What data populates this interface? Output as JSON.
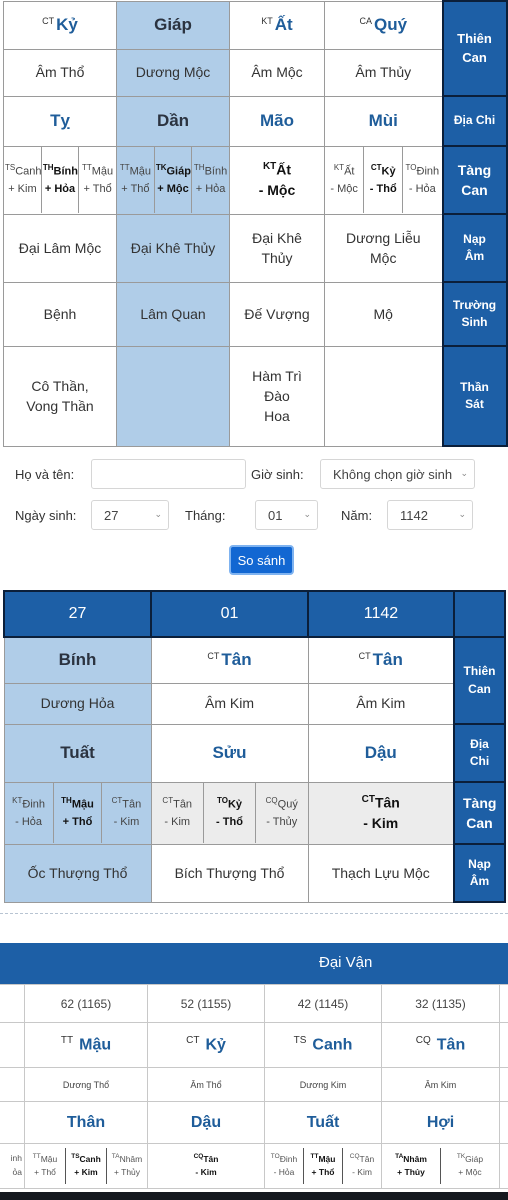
{
  "chart1": {
    "side_labels": {
      "thien_can": "Thiên Can",
      "dia_chi": "Địa Chi",
      "tang_can": "Tàng Can",
      "nap_am": "Nạp Âm",
      "truong_sinh": "Trường Sinh",
      "than_sat": "Thần Sát"
    },
    "columns": [
      {
        "can_sup": "CT",
        "can": "Kỷ",
        "can_hanh": "Âm Thổ",
        "chi": "Tỵ",
        "tang_can": [
          {
            "sup": "TS",
            "name": "Canh",
            "hanh": "+ Kim",
            "bold": false
          },
          {
            "sup": "TH",
            "name": "Bính",
            "hanh": "+ Hỏa",
            "bold": true
          },
          {
            "sup": "TT",
            "name": "Mậu",
            "hanh": "+ Thổ",
            "bold": false
          }
        ],
        "nap_am": "Đại Lâm Mộc",
        "truong_sinh": "Bệnh",
        "than_sat": "Cô Thần, Vong Thần"
      },
      {
        "can_sup": "",
        "can": "Giáp",
        "can_hanh": "Dương Mộc",
        "chi": "Dần",
        "tang_can": [
          {
            "sup": "TT",
            "name": "Mậu",
            "hanh": "+ Thổ",
            "bold": false
          },
          {
            "sup": "TK",
            "name": "Giáp",
            "hanh": "+ Mộc",
            "bold": true
          },
          {
            "sup": "TH",
            "name": "Bính",
            "hanh": "+ Hỏa",
            "bold": false
          }
        ],
        "nap_am": "Đại Khê Thủy",
        "truong_sinh": "Lâm Quan",
        "than_sat": ""
      },
      {
        "can_sup": "KT",
        "can": "Ất",
        "can_hanh": "Âm Mộc",
        "chi": "Mão",
        "tang_can": [
          {
            "sup": "KT",
            "name": "Ất",
            "hanh": "- Mộc",
            "bold": true
          }
        ],
        "nap_am": "Đại Khê Thủy",
        "truong_sinh": "Đế Vượng",
        "than_sat": "Hàm Trì Đào Hoa"
      },
      {
        "can_sup": "CA",
        "can": "Quý",
        "can_hanh": "Âm Thủy",
        "chi": "Mùi",
        "tang_can": [
          {
            "sup": "KT",
            "name": "Ất",
            "hanh": "- Mộc",
            "bold": false
          },
          {
            "sup": "CT",
            "name": "Kỷ",
            "hanh": "- Thổ",
            "bold": true
          },
          {
            "sup": "TO",
            "name": "Đinh",
            "hanh": "- Hỏa",
            "bold": false
          }
        ],
        "nap_am": "Dương Liễu Mộc",
        "truong_sinh": "Mộ",
        "than_sat": ""
      }
    ]
  },
  "form": {
    "name_label": "Họ và tên:",
    "name_value": "",
    "hour_label": "Giờ sinh:",
    "hour_value": "Không chọn giờ sinh",
    "day_label": "Ngày sinh:",
    "day_value": "27",
    "month_label": "Tháng:",
    "month_value": "01",
    "year_label": "Năm:",
    "year_value": "1142",
    "compare_button": "So sánh"
  },
  "chart2": {
    "headers": [
      "27",
      "01",
      "1142"
    ],
    "side_labels": {
      "thien_can": "Thiên Can",
      "dia_chi": "Địa Chi",
      "tang_can": "Tàng Can",
      "nap_am": "Nạp Âm"
    },
    "columns": [
      {
        "can_sup": "",
        "can": "Bính",
        "can_hanh": "Dương Hỏa",
        "chi": "Tuất",
        "tang_can": [
          {
            "sup": "KT",
            "name": "Đinh",
            "hanh": "- Hỏa",
            "bold": false
          },
          {
            "sup": "TH",
            "name": "Mậu",
            "hanh": "+ Thổ",
            "bold": true
          },
          {
            "sup": "CT",
            "name": "Tân",
            "hanh": "- Kim",
            "bold": false
          }
        ],
        "nap_am": "Ốc Thượng Thổ"
      },
      {
        "can_sup": "CT",
        "can": "Tân",
        "can_hanh": "Âm Kim",
        "chi": "Sửu",
        "tang_can": [
          {
            "sup": "CT",
            "name": "Tân",
            "hanh": "- Kim",
            "bold": false
          },
          {
            "sup": "TO",
            "name": "Kỷ",
            "hanh": "- Thổ",
            "bold": true
          },
          {
            "sup": "CQ",
            "name": "Quý",
            "hanh": "- Thủy",
            "bold": false
          }
        ],
        "nap_am": "Bích Thượng Thổ"
      },
      {
        "can_sup": "CT",
        "can": "Tân",
        "can_hanh": "Âm Kim",
        "chi": "Dậu",
        "tang_can": [
          {
            "sup": "CT",
            "name": "Tân",
            "hanh": "- Kim",
            "bold": true
          }
        ],
        "nap_am": "Thạch Lựu Mộc"
      }
    ]
  },
  "dai_van": {
    "title": "Đại Vận",
    "columns": [
      {
        "age": "62 (1165)",
        "can_sup": "TT",
        "can": "Mậu",
        "can_hanh": "Dương Thổ",
        "chi": "Thân",
        "tang_can": [
          {
            "sup": "TT",
            "name": "Mậu",
            "hanh": "+ Thổ",
            "bold": false
          },
          {
            "sup": "TS",
            "name": "Canh",
            "hanh": "+ Kim",
            "bold": true
          },
          {
            "sup": "TA",
            "name": "Nhâm",
            "hanh": "+ Thủy",
            "bold": false
          }
        ]
      },
      {
        "age": "52 (1155)",
        "can_sup": "CT",
        "can": "Kỷ",
        "can_hanh": "Âm Thổ",
        "chi": "Dậu",
        "tang_can": [
          {
            "sup": "CQ",
            "name": "Tân",
            "hanh": "- Kim",
            "bold": true
          }
        ]
      },
      {
        "age": "42 (1145)",
        "can_sup": "TS",
        "can": "Canh",
        "can_hanh": "Dương Kim",
        "chi": "Tuất",
        "tang_can": [
          {
            "sup": "TO",
            "name": "Đinh",
            "hanh": "- Hỏa",
            "bold": false
          },
          {
            "sup": "TT",
            "name": "Mậu",
            "hanh": "+ Thổ",
            "bold": true
          },
          {
            "sup": "CQ",
            "name": "Tân",
            "hanh": "- Kim",
            "bold": false
          }
        ]
      },
      {
        "age": "32 (1135)",
        "can_sup": "CQ",
        "can": "Tân",
        "can_hanh": "Âm Kim",
        "chi": "Hợi",
        "tang_can": [
          {
            "sup": "TA",
            "name": "Nhâm",
            "hanh": "+ Thủy",
            "bold": true
          },
          {
            "sup": "TK",
            "name": "Giáp",
            "hanh": "+ Mộc",
            "bold": false
          }
        ]
      }
    ],
    "partial_left_tang_can": {
      "name_fragment": "inh",
      "hanh_fragment": "ỏa"
    }
  }
}
